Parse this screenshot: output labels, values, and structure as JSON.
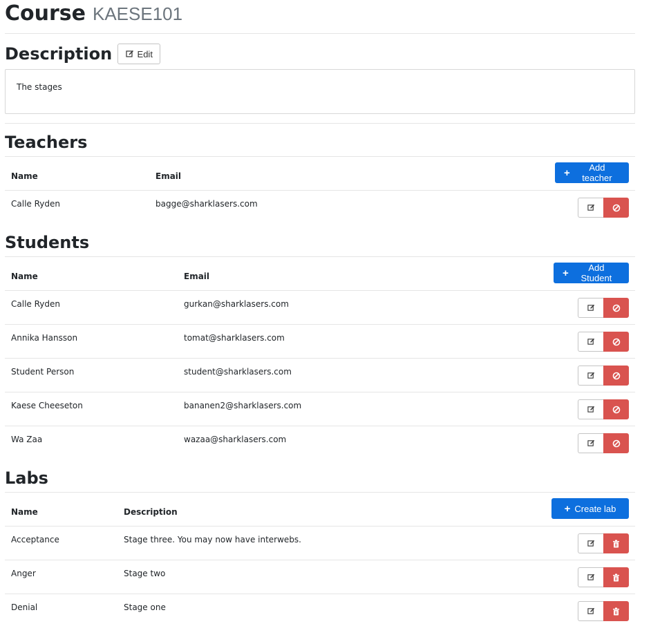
{
  "course": {
    "heading": "Course",
    "code": "KAESE101"
  },
  "description": {
    "heading": "Description",
    "edit_label": "Edit",
    "text": "The stages"
  },
  "teachers": {
    "heading": "Teachers",
    "columns": [
      "Name",
      "Email"
    ],
    "add_label": "Add teacher",
    "rows": [
      {
        "name": "Calle Ryden",
        "email": "bagge@sharklasers.com"
      }
    ]
  },
  "students": {
    "heading": "Students",
    "columns": [
      "Name",
      "Email"
    ],
    "add_label": "Add Student",
    "rows": [
      {
        "name": "Calle Ryden",
        "email": "gurkan@sharklasers.com"
      },
      {
        "name": "Annika Hansson",
        "email": "tomat@sharklasers.com"
      },
      {
        "name": "Student Person",
        "email": "student@sharklasers.com"
      },
      {
        "name": "Kaese Cheeseton",
        "email": "bananen2@sharklasers.com"
      },
      {
        "name": "Wa Zaa",
        "email": "wazaa@sharklasers.com"
      }
    ]
  },
  "labs": {
    "heading": "Labs",
    "columns": [
      "Name",
      "Description"
    ],
    "add_label": "Create lab",
    "rows": [
      {
        "name": "Acceptance",
        "description": "Stage three. You may now have interwebs."
      },
      {
        "name": "Anger",
        "description": "Stage two"
      },
      {
        "name": "Denial",
        "description": "Stage one"
      }
    ]
  },
  "icons": {
    "edit": "edit-icon",
    "remove": "ban-icon",
    "delete": "trash-icon",
    "add": "plus-icon"
  },
  "colors": {
    "primary": "#0d6fde",
    "danger": "#d9534f",
    "muted": "#6c757d"
  }
}
